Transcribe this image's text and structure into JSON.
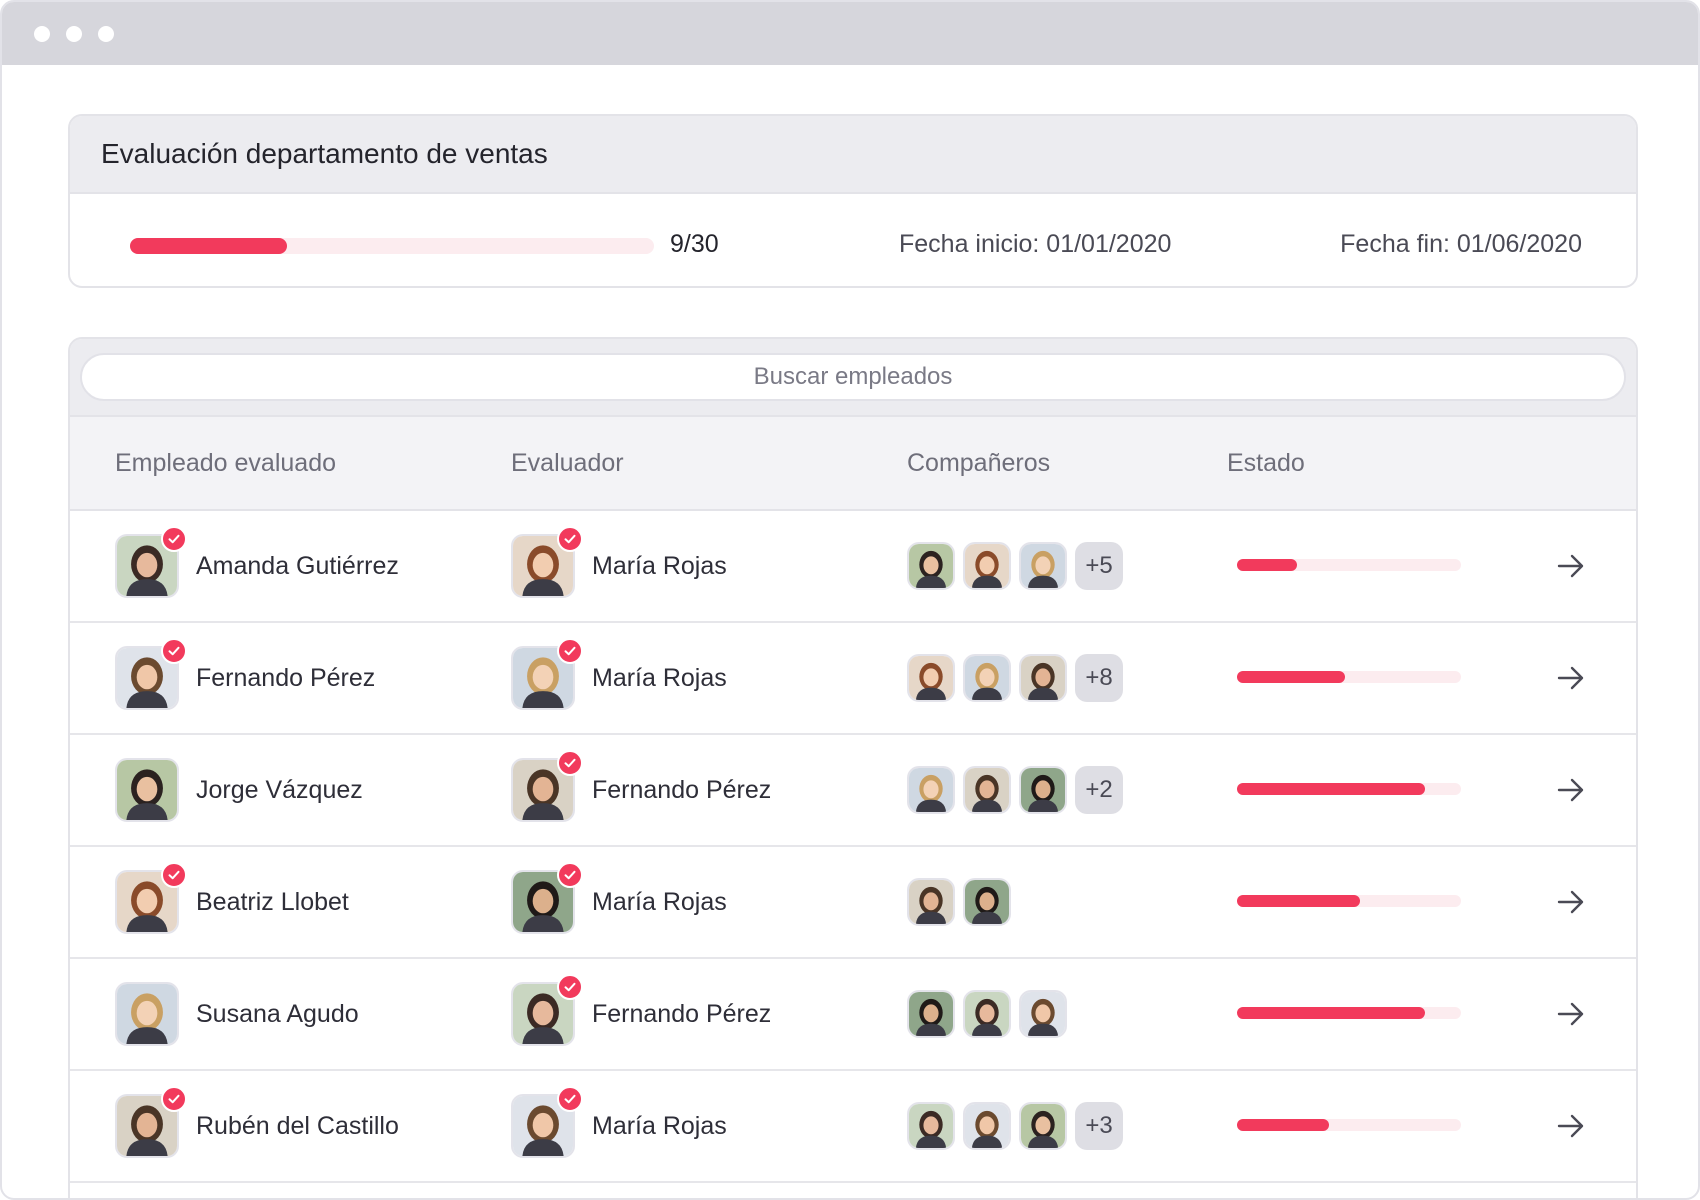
{
  "summary": {
    "title": "Evaluación departamento de ventas",
    "progress_fraction": 0.3,
    "progress_text": "9/30",
    "start_date": "Fecha inicio: 01/01/2020",
    "end_date": "Fecha fin: 01/06/2020"
  },
  "search": {
    "placeholder": "Buscar empleados"
  },
  "table": {
    "headers": [
      "Empleado evaluado",
      "Evaluador",
      "Compañeros",
      "Estado"
    ],
    "rows": [
      {
        "employee": "Amanda Gutiérrez",
        "employee_checked": true,
        "evaluator": "María Rojas",
        "evaluator_checked": true,
        "peers_shown": 3,
        "peers_more": "+5",
        "status": 0.27
      },
      {
        "employee": "Fernando Pérez",
        "employee_checked": true,
        "evaluator": "María Rojas",
        "evaluator_checked": true,
        "peers_shown": 3,
        "peers_more": "+8",
        "status": 0.48
      },
      {
        "employee": "Jorge Vázquez",
        "employee_checked": false,
        "evaluator": "Fernando Pérez",
        "evaluator_checked": true,
        "peers_shown": 3,
        "peers_more": "+2",
        "status": 0.84
      },
      {
        "employee": "Beatriz Llobet",
        "employee_checked": true,
        "evaluator": "María Rojas",
        "evaluator_checked": true,
        "peers_shown": 2,
        "peers_more": "",
        "status": 0.55
      },
      {
        "employee": "Susana Agudo",
        "employee_checked": false,
        "evaluator": "Fernando Pérez",
        "evaluator_checked": true,
        "peers_shown": 3,
        "peers_more": "",
        "status": 0.84
      },
      {
        "employee": "Rubén del Castillo",
        "employee_checked": true,
        "evaluator": "María Rojas",
        "evaluator_checked": true,
        "peers_shown": 3,
        "peers_more": "+3",
        "status": 0.41
      }
    ]
  },
  "colors": {
    "accent": "#f23a5c",
    "track": "#fcecef",
    "header_bg": "#ececf0"
  },
  "icons": {
    "row_action": "arrow-right-icon",
    "check": "check-icon",
    "avatar": "user-avatar-icon"
  }
}
